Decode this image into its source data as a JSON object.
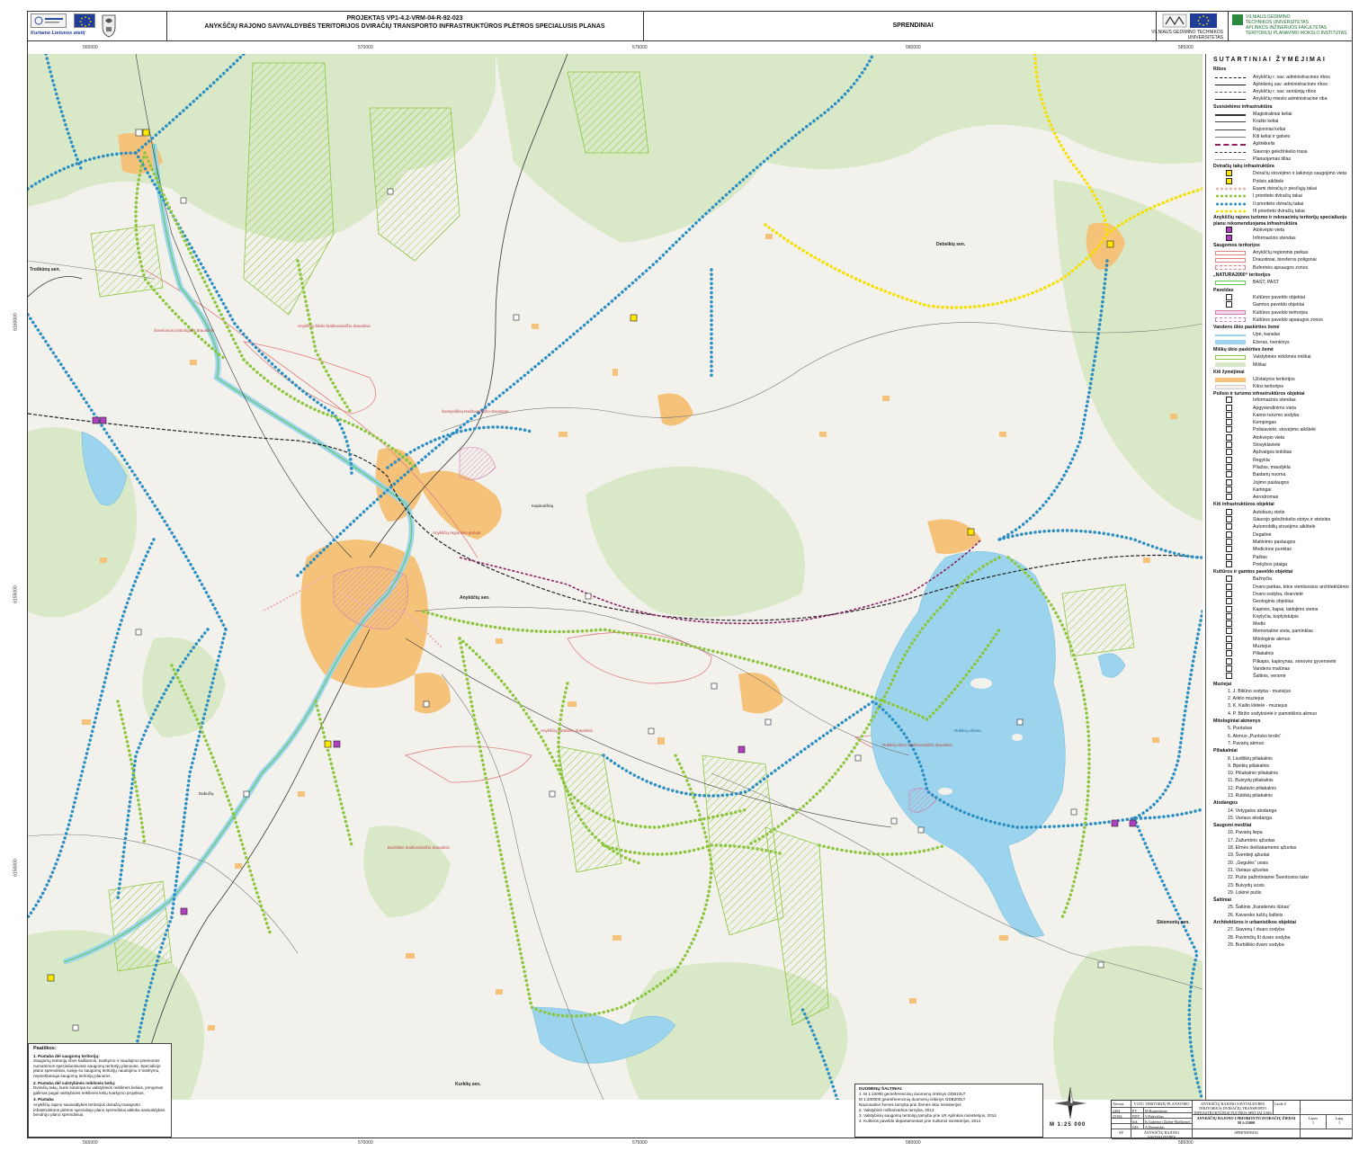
{
  "header": {
    "project_line": "PROJEKTAS VP1-4.2-VRM-04-R-92-023",
    "title_line": "ANYKŠČIŲ RAJONO SAVIVALDYBĖS TERITORIJOS DVIRAČIŲ TRANSPORTO INFRASTRUKTŪROS PLĖTROS SPECIALUSIS PLANAS",
    "section": "SPRENDINIAI",
    "eu_slogan": "Kuriame Lietuvos ateitį",
    "university": "VILNIAUS GEDIMINO TECHNIKOS UNIVERSITETAS",
    "institute_lines": [
      "VILNIAUS GEDIMINO",
      "TECHNIKOS UNIVERSITETAS",
      "APLINKOS INŽINERIJOS FAKULTETAS",
      "TERITORIJŲ PLANAVIMO MOKSLO INSTITUTAS"
    ]
  },
  "map": {
    "coords_top": [
      "565000",
      "570000",
      "575000",
      "580000",
      "585000"
    ],
    "coords_bottom": [
      "565000",
      "570000",
      "575000",
      "580000",
      "585000"
    ],
    "coords_left": [
      "6160000",
      "6155000",
      "6150000"
    ],
    "coords_right": [
      "6160000",
      "6155000",
      "6150000"
    ],
    "eldership_labels": [
      "Troškūnų sen.",
      "Debeikių sen.",
      "Anykščių sen.",
      "Skiemonių sen.",
      "Kurklių sen."
    ],
    "place_labels": [
      "Anykščių šilelio kraštovaizdžio draustinis",
      "Šventosios ichtiologinis draustinis",
      "Šeimyniškių kraštovaizdžio draustinis",
      "Rubikių ežero kraštovaizdžio draustinis",
      "Anykščių botaninis draustinis",
      "Burbiškio kraštovaizdžio draustinis",
      "Anykščių regioninis parkas",
      "Rubikių ežeras",
      "Kapitoniškių",
      "Dabužių"
    ]
  },
  "colors": {
    "bike_existing": "#e6b3b3",
    "bike_priority_1": "#8cc63f",
    "bike_priority_2": "#2b8fc4",
    "bike_priority_3": "#f5e000",
    "water": "#9bd4ec",
    "forest": "#d8e8c8",
    "settlement": "#f5c27a",
    "natura": "#5cc84e",
    "heritage": "#d07eb0"
  },
  "legend": {
    "title": "SUTARTINIAI ŽYMĖJIMAI",
    "sections": [
      {
        "title": "Ribos",
        "items": [
          "Anykščių r. sav. administracinės ribos",
          "Aplinkinių sav. administracinės ribos",
          "Anykščių r. sav. seniūnijų ribos",
          "Anykščių miesto administracinė riba"
        ]
      },
      {
        "title": "Susisiekimo infrastruktūra",
        "items": [
          "Magistraliniai keliai",
          "Krašto keliai",
          "Rajoniniai keliai",
          "Kiti keliai ir gatvės",
          "Aplinkkelis",
          "Siaurojo geležinkelio trasa",
          "Planuojamas tiltas"
        ]
      },
      {
        "title": "Dviračių takų infrastruktūra",
        "items": [
          "Dviračių stovėjimo ir laikinojo saugojimo vieta",
          "Poilsio aikštelė",
          "Esami dviračių ir pėsčiųjų takai",
          "I prioriteto dviračių takai",
          "II prioriteto dviračių takai",
          "III prioriteto dviračių takai"
        ]
      },
      {
        "title": "Anykščių rajono turizmo ir rekreacinių teritorijų specialiuoju planu rekomenduojama infrastruktūra",
        "items": [
          "Atokvėpio vieta",
          "Informacinis stendas"
        ]
      },
      {
        "title": "Saugomos teritorijos",
        "items": [
          "Anykščių regioninis parkas",
          "Draustiniai, biosferos poligonai",
          "Buferinės apsaugos zonos"
        ]
      },
      {
        "title": "„NATURA2000“ teritorijos",
        "items": [
          "BAST, PAST"
        ]
      },
      {
        "title": "Paveldas",
        "items": [
          "Kultūros paveldo objektai",
          "Gamtos paveldo objektai",
          "Kultūros paveldo teritorijos",
          "Kultūros paveldo apsaugos zonos"
        ]
      },
      {
        "title": "Vandens ūkio paskirties žemė",
        "items": [
          "Upė, kanalas",
          "Ežeras, tvenkinys"
        ]
      },
      {
        "title": "Miškų ūkio paskirties žemė",
        "items": [
          "Valstybinės reikšmės miškai",
          "Miškai"
        ]
      },
      {
        "title": "Kiti žymėjimai",
        "items": [
          "Užstatytos teritorijos",
          "Kitos teritorijos"
        ]
      },
      {
        "title": "Poilsio ir turizmo infrastruktūros objektai",
        "items": [
          "Informacinis stendas",
          "Apgyvendinimo vieta",
          "Kaimo turizmo sodyba",
          "Kempingas",
          "Poilsiavietė, stovėjimo aikštelė",
          "Atokvėpio vieta",
          "Stovyklavietė",
          "Apžvalgos bokštas",
          "Regykla",
          "Pliažas, maudykla",
          "Baidarių nuoma",
          "Jojimo paslaugos",
          "Kartingai",
          "Aerodromas"
        ]
      },
      {
        "title": "Kiti infrastruktūros objektai",
        "items": [
          "Autobusų stotis",
          "Siaurojo geležinkelio stotys ir stotelės",
          "Automobilių stovėjimo aikštelė",
          "Degalinė",
          "Maitinimo paslaugos",
          "Medicinos punktas",
          "Paštas",
          "Prekybos įstaiga"
        ]
      },
      {
        "title": "Kultūros ir gamtos paveldo objektai",
        "items": [
          "Bažnyčia",
          "Dvaro parkas, kitos vientisosios architektūrinės grupės",
          "Dvaro sodyba, dvarvietė",
          "Geologinis objektas",
          "Kapinės, kapai, laidojimo vietos",
          "Koplyčia, koplytstulpis",
          "Medis",
          "Memorialinė vieta, paminklas",
          "Mitologinis akmuo",
          "Muziejus",
          "Piliakalnis",
          "Pilkapis, kapinynas, senovės gyvenvietė",
          "Vandens malūnas",
          "Šaltinis, versmė"
        ]
      },
      {
        "title": "Muziejai",
        "numbered": [
          "1. J. Biliūno sodyba - muziejus",
          "2. Arklio muziejus",
          "3. K. Kailio klėtelė - muziejus",
          "4. P. Biržio sodybvietė ir paminklinis akmuo"
        ]
      },
      {
        "title": "Mitologiniai akmenys",
        "numbered": [
          "5. Puntukas",
          "6. Akmuo „Puntuko brolis“",
          "7. Pavarių akmuo"
        ]
      },
      {
        "title": "Piliakalniai",
        "numbered": [
          "8. Liudiškių piliakalnis",
          "9. Bijeikių piliakalnis",
          "10. Piliakalnio piliakalnis",
          "11. Buivydų piliakalnis",
          "12. Palatavio piliakalnis",
          "13. Rubikių piliakalnis"
        ]
      },
      {
        "title": "Atodangos",
        "numbered": [
          "14. Vetygalos atodanga",
          "15. Variaus atodanga"
        ]
      },
      {
        "title": "Saugomi medžiai",
        "numbered": [
          "16. Pavarių liepa",
          "17. Žažumbrio ąžuolas",
          "18. Elmės išeišakamenis ąžuolas",
          "19. Šventieji ąžuolai",
          "20. „Gegulės“ uosis",
          "21. Variaus ąžuolas",
          "22. Pušis pažintiniame Šventosios take",
          "23. Buivydų uosis",
          "29. Lokinė pušis"
        ]
      },
      {
        "title": "Šaltiniai",
        "numbered": [
          "25. Šaltinis „Karalienės liūnas“",
          "26. Kavarsko tuščų šaltinis"
        ]
      },
      {
        "title": "Architektūros ir urbanistikos objektai",
        "numbered": [
          "27. Siavėnų I dvaro sodyba",
          "28. Pavirinčių III dvaro sodyba",
          "29. Burbiškio dvaro sodyba"
        ]
      }
    ]
  },
  "notes": {
    "title": "Paaiškos:",
    "items": [
      {
        "head": "1. Pastaba dėl saugomų teritorijų:",
        "text": "Saugomų teritorijų ribos kaišiamos, tvarkymo ir naudojimo priemonės numatomos specialiuosiuose saugomų teritorijų planuose. Specialiojo plano sprendiniai, susiję su saugomų teritorijų naudojimu ir tvarkymu, neprieštarauja saugomų teritorijų planams."
      },
      {
        "head": "2. Pastaba dėl valstybinės reikšmės kelių:",
        "text": "Dviračių takų, kurie sutampa su valstybinės reikšmės keliais, įrengimas galimas pagal valstybinės reikšmės kelių tvarkymo projektus."
      },
      {
        "head": "3. Pastaba",
        "text": "Anykščių rajono savivaldybės teritorijos dviračių transporto infrastruktūros plėtros specialiojo plano sprendiniai atitinka savivaldybės bendrojo plano sprendinius."
      }
    ]
  },
  "sources": {
    "title": "DUOMENŲ ŠALTINIAI:",
    "items": [
      "1. M 1:10000 georeferencinių duomenų rinkinys GDB10LT",
      "M 1:200000 georeferencinių duomenų rinkinys GDB200LT",
      "Nacionalinė žemės tarnyba prie Žemės ūkio ministerijos",
      "2. Valstybinė miškotvarkos tarnyba, 2013",
      "3. Valstybinių saugomų teritorijų tarnyba prie LR Aplinkos ministerijos, 2014",
      "4. Kultūros paveldo departamentas prie Kultūros ministerijos, 2014"
    ]
  },
  "scale_text": "M 1:25 000",
  "titleblock": {
    "col_heads": [
      "Atestat. Nr.",
      "VGTU TERITORIJŲ PLANAVIMO MOKSLO INSTITUTAS"
    ],
    "people": [
      {
        "num": "2404",
        "role": "PV",
        "name": "M.Burinskienė"
      },
      {
        "num": "25394",
        "role": "PDV",
        "name": "V.Palevičius"
      },
      {
        "num": "",
        "role": "Inž.",
        "name": "K.Gabrėnė (Zilėnė-Šlačbienė)"
      },
      {
        "num": "",
        "role": "GIS inž.",
        "name": "A.Bereniskis"
      }
    ],
    "project_name": "ANYKŠČIŲ RAJONO SAVIVALDYBĖS TERITORIJOS DVIRAČIŲ TRANSPORTO INFRASTRUKTŪROS PLĖTROS SPECIALUSIS PLANAS",
    "sheet_title": "ANYKŠČIŲ RAJONO I PRIORITETO DVIRAČIŲ ŽIEDAI",
    "sheet_scale": "M 1:25000",
    "stage": "SP",
    "client": "ANYKŠČIŲ RAJONO SAVIVALDYBĖS ADMINISTRACIJA",
    "doc_type": "SPRENDINIAI",
    "sheet_label": "Lapas",
    "sheets_label": "Lapų",
    "sheet_no": "1",
    "sheets_total": "1",
    "edition_label": "Laida",
    "edition": "0"
  }
}
